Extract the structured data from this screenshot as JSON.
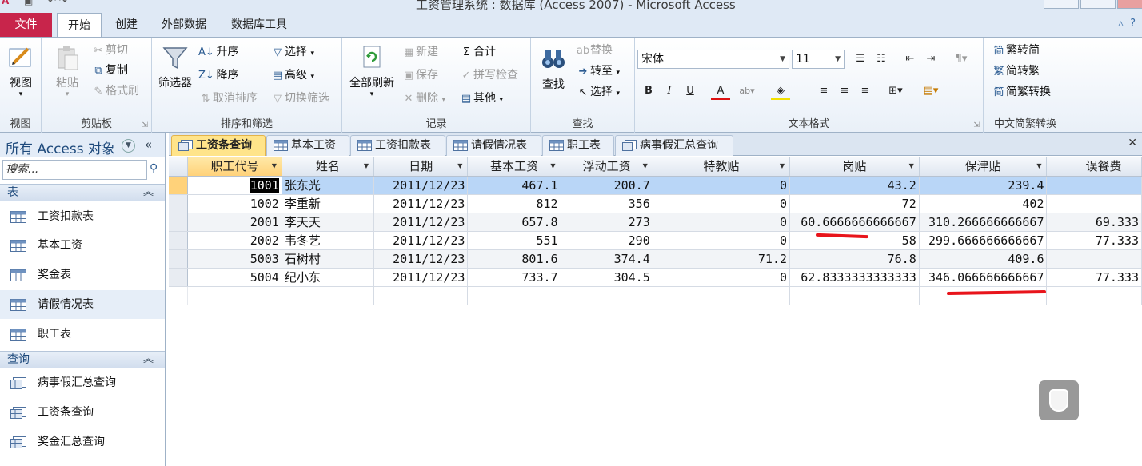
{
  "window": {
    "title": "工资管理系统 : 数据库 (Access 2007) - Microsoft Access"
  },
  "ribbon": {
    "tabs": [
      "文件",
      "开始",
      "创建",
      "外部数据",
      "数据库工具"
    ],
    "active_tab": "开始",
    "groups": {
      "view": {
        "label": "视图",
        "button": "视图"
      },
      "clipboard": {
        "label": "剪贴板",
        "paste": "粘贴",
        "cut": "剪切",
        "copy": "复制",
        "format_painter": "格式刷"
      },
      "sort_filter": {
        "label": "排序和筛选",
        "filter": "筛选器",
        "asc": "升序",
        "desc": "降序",
        "remove_sort": "取消排序",
        "selection": "选择",
        "advanced": "高级",
        "toggle_filter": "切换筛选"
      },
      "records": {
        "label": "记录",
        "refresh_all": "全部刷新",
        "new": "新建",
        "save": "保存",
        "delete": "删除",
        "totals": "合计",
        "spelling": "拼写检查",
        "more": "其他"
      },
      "find": {
        "label": "查找",
        "find": "查找",
        "replace": "替换",
        "goto": "转至",
        "select": "选择"
      },
      "text_format": {
        "label": "文本格式",
        "font": "宋体",
        "size": "11"
      },
      "chinese": {
        "label": "中文简繁转换",
        "to_simplified": "繁转简",
        "to_traditional": "简转繁",
        "convert": "简繁转换"
      }
    }
  },
  "nav": {
    "title": "所有 Access 对象",
    "search_placeholder": "搜索...",
    "sections": [
      {
        "label": "表",
        "items": [
          "工资扣款表",
          "基本工资",
          "奖金表",
          "请假情况表",
          "职工表"
        ]
      },
      {
        "label": "查询",
        "items": [
          "病事假汇总查询",
          "工资条查询",
          "奖金汇总查询"
        ]
      }
    ]
  },
  "doc_tabs": [
    "工资条查询",
    "基本工资",
    "工资扣款表",
    "请假情况表",
    "职工表",
    "病事假汇总查询"
  ],
  "active_doc_tab": "工资条查询",
  "grid": {
    "columns": [
      "职工代号",
      "姓名",
      "日期",
      "基本工资",
      "浮动工资",
      "特教贴",
      "岗贴",
      "保津贴",
      "误餐费"
    ],
    "rows": [
      [
        "1001",
        "张东光",
        "2011/12/23",
        "467.1",
        "200.7",
        "0",
        "43.2",
        "239.4",
        ""
      ],
      [
        "1002",
        "李重新",
        "2011/12/23",
        "812",
        "356",
        "0",
        "72",
        "402",
        ""
      ],
      [
        "2001",
        "李天天",
        "2011/12/23",
        "657.8",
        "273",
        "0",
        "60.6666666666667",
        "310.266666666667",
        "69.333"
      ],
      [
        "2002",
        "韦冬艺",
        "2011/12/23",
        "551",
        "290",
        "0",
        "58",
        "299.666666666667",
        "77.333"
      ],
      [
        "5003",
        "石树村",
        "2011/12/23",
        "801.6",
        "374.4",
        "71.2",
        "76.8",
        "409.6",
        ""
      ],
      [
        "5004",
        "纪小东",
        "2011/12/23",
        "733.7",
        "304.5",
        "0",
        "62.8333333333333",
        "346.066666666667",
        "77.333"
      ]
    ]
  },
  "colors": {
    "accent": "#c8254b",
    "annotation": "#e8141b",
    "selection": "#b9d6f7"
  }
}
